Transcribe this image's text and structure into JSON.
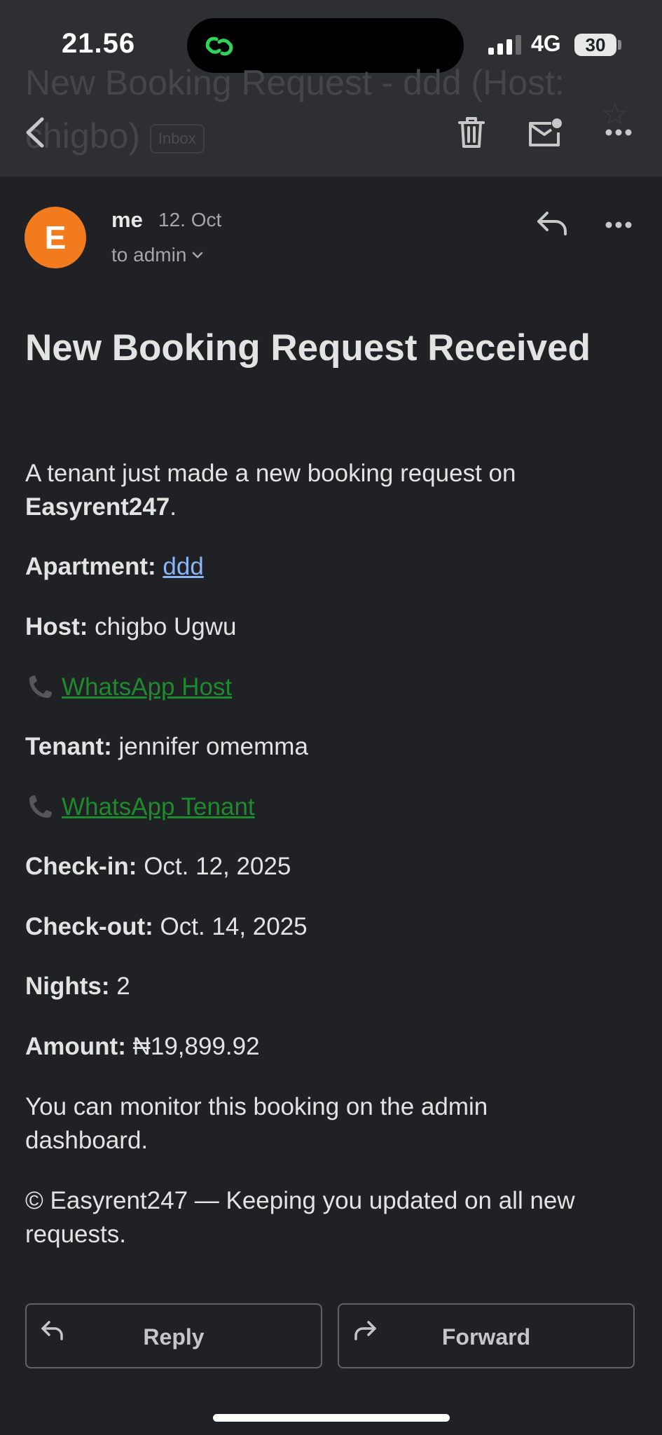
{
  "status_bar": {
    "time": "21.56",
    "network": "4G",
    "battery": "30"
  },
  "header": {
    "subject": "New Booking Request - ddd (Host: chigbo)",
    "label_chip": "Inbox"
  },
  "message": {
    "sender_initial": "E",
    "sender": "me",
    "date": "12. Oct",
    "recipient": "to admin",
    "avatar_color": "#f27c1d"
  },
  "email": {
    "title": "New Booking Request Received",
    "intro": "A tenant just made a new booking request on",
    "brand": "Easyrent247",
    "intro_end": ".",
    "apartment_label": "Apartment:",
    "apartment_value": "ddd",
    "host_label": "Host:",
    "host_value": "chigbo Ugwu",
    "whatsapp_host": "WhatsApp Host",
    "tenant_label": "Tenant:",
    "tenant_value": "jennifer omemma",
    "whatsapp_tenant": "WhatsApp Tenant",
    "checkin_label": "Check-in:",
    "checkin_value": "Oct. 12, 2025",
    "checkout_label": "Check-out:",
    "checkout_value": "Oct. 14, 2025",
    "nights_label": "Nights:",
    "nights_value": "2",
    "amount_label": "Amount:",
    "amount_value": "₦19,899.92",
    "monitor_text": "You can monitor this booking on the admin dashboard.",
    "footer_text": "© Easyrent247 — Keeping you updated on all new requests."
  },
  "actions": {
    "reply": "Reply",
    "forward": "Forward"
  },
  "colors": {
    "background": "#202124",
    "toolbar": "#2e2f32",
    "link_blue": "#8ab4f8",
    "link_green": "#1e8a2e"
  }
}
